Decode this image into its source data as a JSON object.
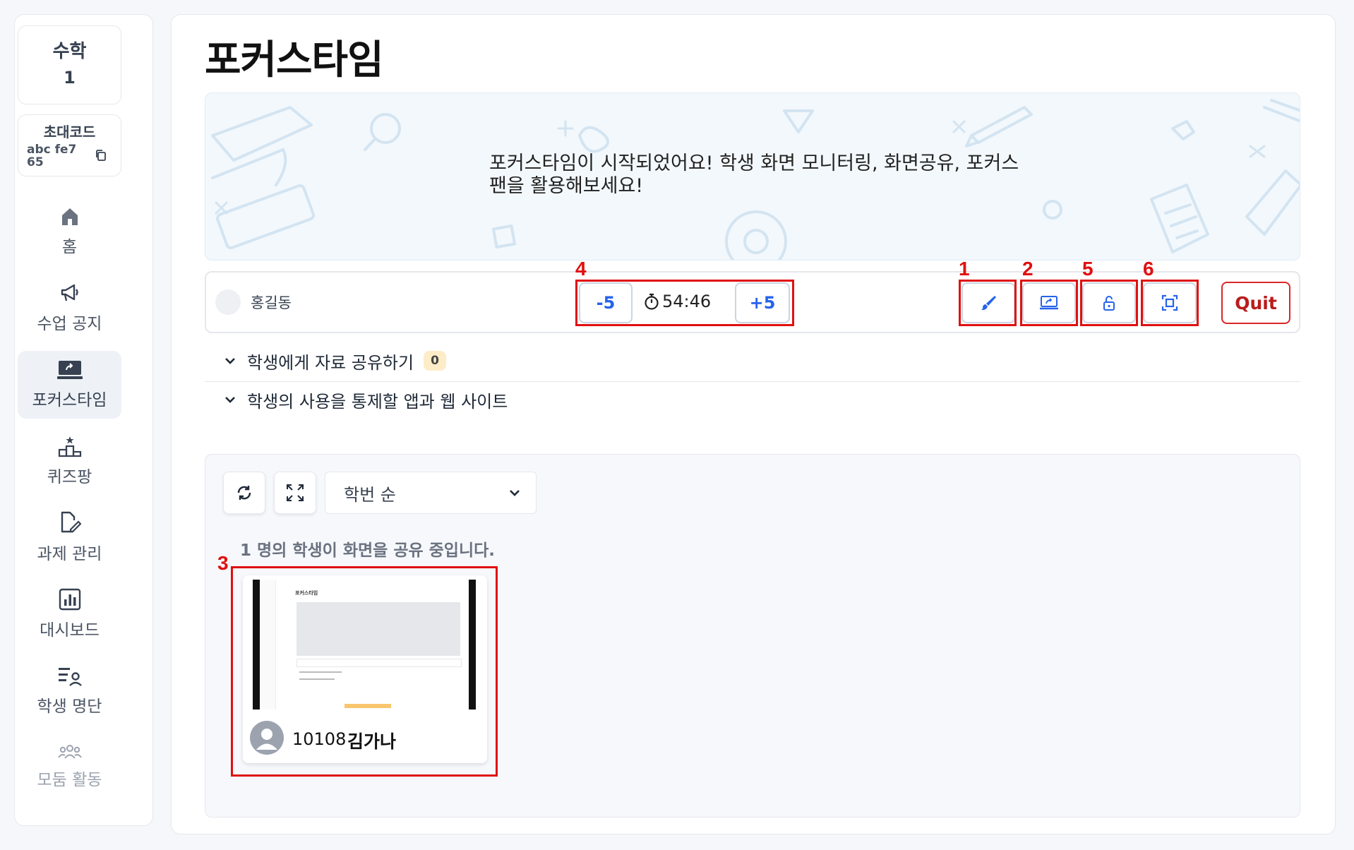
{
  "sidebar": {
    "class_name": "수학",
    "class_number": "1",
    "invite_title": "초대코드",
    "invite_code": "abc fe7 65",
    "items": [
      {
        "label": "홈",
        "icon": "home-icon"
      },
      {
        "label": "수업 공지",
        "icon": "megaphone-icon"
      },
      {
        "label": "포커스타임",
        "icon": "screen-share-icon",
        "active": true
      },
      {
        "label": "퀴즈팡",
        "icon": "podium-icon"
      },
      {
        "label": "과제 관리",
        "icon": "edit-doc-icon"
      },
      {
        "label": "대시보드",
        "icon": "bar-chart-icon"
      },
      {
        "label": "학생 명단",
        "icon": "user-list-icon"
      },
      {
        "label": "모둠 활동",
        "icon": "group-icon",
        "muted": true
      }
    ]
  },
  "main": {
    "title": "포커스타임",
    "banner_text": "포커스타임이 시작되었어요! 학생 화면 모니터링, 화면공유, 포커스팬을 활용해보세요!",
    "teacher_name": "홍길동",
    "timer": {
      "minus_label": "-5",
      "time": "54:46",
      "plus_label": "+5"
    },
    "tools": [
      {
        "icon": "brush-icon"
      },
      {
        "icon": "screen-share-icon"
      },
      {
        "icon": "lock-icon"
      },
      {
        "icon": "focus-frame-icon"
      }
    ],
    "quit_label": "Quit",
    "sections": [
      {
        "label": "학생에게 자료 공유하기",
        "badge": "0"
      },
      {
        "label": "학생의 사용을 통제할 앱과 웹 사이트"
      }
    ],
    "sort_value": "학번 순",
    "share_status": "1 명의 학생이 화면을 공유 중입니다.",
    "students": [
      {
        "id": "10108",
        "name": "김가나"
      }
    ],
    "thumbnail_title": "포커스타임"
  },
  "annotations": [
    "1",
    "2",
    "3",
    "4",
    "5",
    "6"
  ],
  "colors": {
    "accent": "#2563eb",
    "quit": "#dc2626",
    "annotation": "#e01010",
    "active_nav": "#eef2f7"
  }
}
